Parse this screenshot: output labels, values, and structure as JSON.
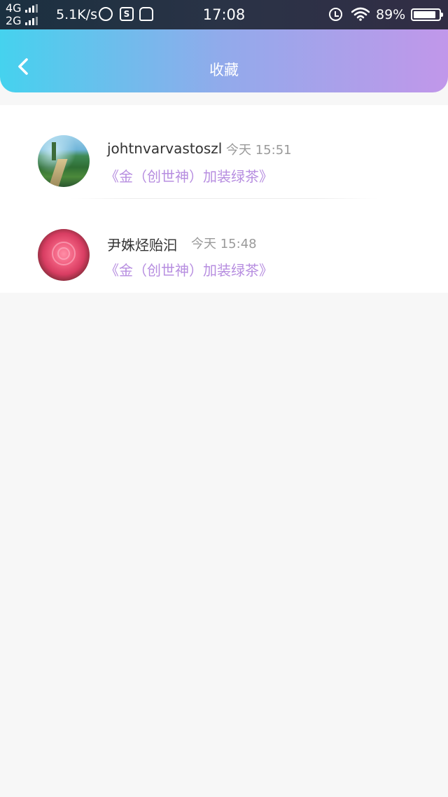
{
  "status_bar": {
    "network_1": "4G",
    "network_2": "2G",
    "speed": "5.1K/s",
    "time": "17:08",
    "battery_percent": "89%",
    "battery_level": 0.89,
    "icons": [
      "signal-bars-icon",
      "globe-icon",
      "s-app-icon",
      "database-icon",
      "alarm-icon",
      "wifi-icon",
      "battery-icon"
    ]
  },
  "nav": {
    "title": "收藏",
    "back_icon": "chevron-left-icon"
  },
  "favorites": [
    {
      "user": "johtnvarvastoszl",
      "time": "今天 15:51",
      "book": "《金（创世神）加装绿茶》",
      "avatar": "landscape-avatar"
    },
    {
      "user": "尹姝烃贻汩",
      "time": "今天 15:48",
      "book": "《金（创世神）加装绿茶》",
      "avatar": "rose-avatar"
    }
  ],
  "colors": {
    "header_gradient_start": "#45d2ee",
    "header_gradient_end": "#c197ea",
    "book_title": "#b78ee0",
    "background": "#f7f7f7"
  }
}
